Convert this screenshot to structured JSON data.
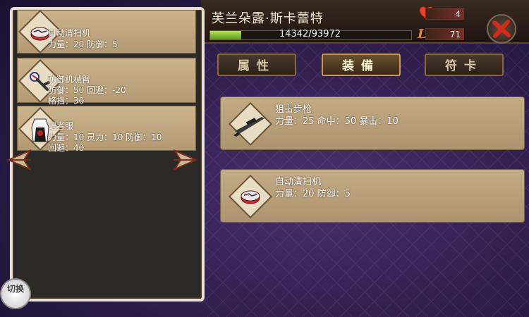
{
  "character": {
    "name": "芙兰朵露·斯卡蕾特",
    "exp_text": "14342/93972",
    "exp_fraction": 0.153,
    "hearts": "4",
    "level_label": "Lv",
    "level": "71"
  },
  "tabs": [
    {
      "label": "属性",
      "active": false
    },
    {
      "label": "装備",
      "active": true
    },
    {
      "label": "符卡",
      "active": false
    }
  ],
  "inventory": [
    {
      "name": "自动清扫机",
      "stats": [
        "力量：20 防御：5"
      ],
      "icon": "robot-vacuum-icon"
    },
    {
      "name": "防御机械臂",
      "stats": [
        "防御：50 回避：-20",
        "格挡：30"
      ],
      "icon": "mechanical-arm-icon"
    },
    {
      "name": "记者服",
      "stats": [
        "力量：10 灵力：10 防御：10",
        "回避：40"
      ],
      "icon": "reporter-outfit-icon"
    }
  ],
  "equipped": [
    {
      "name": "狙击步枪",
      "stats": "力量：25 命中：50 暴击：10",
      "icon": "sniper-rifle-icon"
    },
    {
      "name": "自动清扫机",
      "stats": "力量：20 防御：5",
      "icon": "robot-vacuum-icon"
    }
  ],
  "switch_label": "切换",
  "colors": {
    "accent": "#c89a50",
    "card": "#bca37c",
    "exp": "#8cc43a"
  }
}
